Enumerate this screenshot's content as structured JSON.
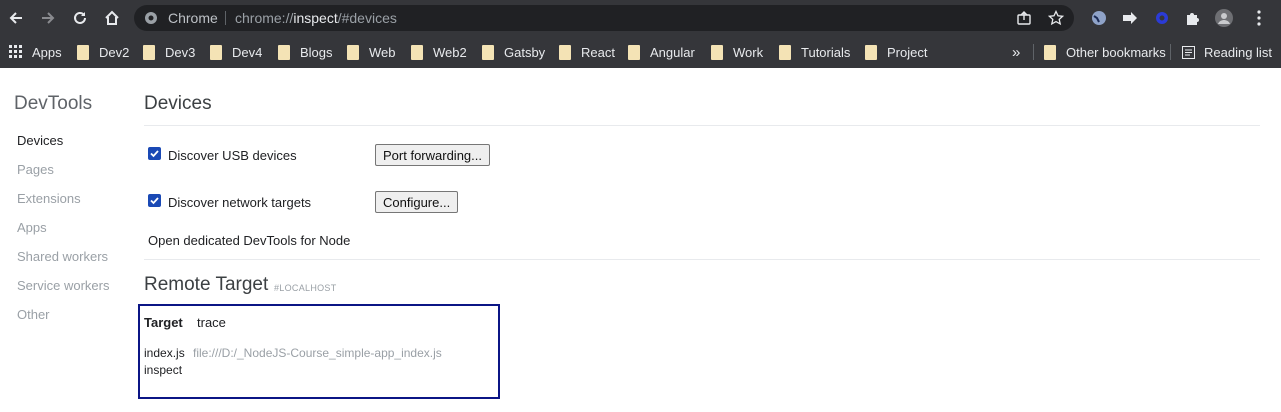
{
  "browser": {
    "omnibox_site": "Chrome",
    "omnibox_url_prefix": "chrome://",
    "omnibox_url_host": "inspect",
    "omnibox_url_suffix": "/#devices"
  },
  "bookmarks": {
    "apps": "Apps",
    "items": [
      "Dev2",
      "Dev3",
      "Dev4",
      "Blogs",
      "Web",
      "Web2",
      "Gatsby",
      "React",
      "Angular",
      "Work",
      "Tutorials",
      "Project"
    ],
    "more": "»",
    "other": "Other bookmarks",
    "reading_list": "Reading list"
  },
  "sidebar": {
    "title": "DevTools",
    "items": [
      "Devices",
      "Pages",
      "Extensions",
      "Apps",
      "Shared workers",
      "Service workers",
      "Other"
    ],
    "active": "Devices"
  },
  "main": {
    "title": "Devices",
    "discover_usb": {
      "label": "Discover USB devices",
      "checked": true
    },
    "port_forwarding_button": "Port forwarding...",
    "discover_network": {
      "label": "Discover network targets",
      "checked": true
    },
    "configure_button": "Configure...",
    "node_devtools_link": "Open dedicated DevTools for Node",
    "remote_target_title": "Remote Target",
    "remote_target_host": "#LOCALHOST",
    "target_label": "Target",
    "target_name": "trace",
    "target_file": "index.js",
    "target_url": "file:///D:/_NodeJS-Course_simple-app_index.js",
    "inspect_link": "inspect"
  },
  "colors": {
    "toolbar": "#35363a",
    "omnibox": "#202124",
    "checkbox": "#1a49b5",
    "highlight_box": "#0b1585"
  }
}
